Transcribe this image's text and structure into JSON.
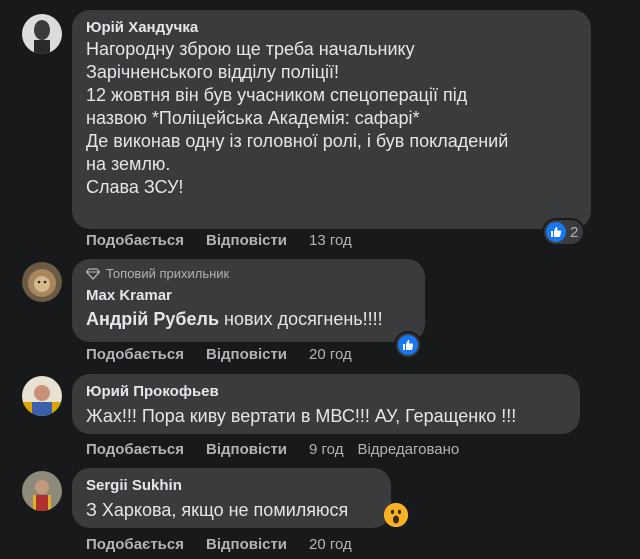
{
  "comments": [
    {
      "author": "Юрій Хандучка",
      "lines": [
        "Нагородну зброю ще треба начальнику",
        "Зарічненського відділу поліції!",
        "12 жовтня він був учасником спецоперації під",
        "назвою *Поліцейська Академія: сафарі*",
        "Де виконав одну із головної ролі, і був покладений",
        "на землю.",
        "Слава ЗСУ!"
      ],
      "like_label": "Подобається",
      "reply_label": "Відповісти",
      "time": "13 год",
      "reaction_count": "2",
      "reaction_icon": "like-icon"
    },
    {
      "badge": "Топовий прихильник",
      "author": "Max Kramar",
      "mention": "Андрій Рубель",
      "text": " нових досягнень!!!!",
      "like_label": "Подобається",
      "reply_label": "Відповісти",
      "time": "20 год",
      "reaction_icon": "like-icon"
    },
    {
      "author": "Юрий Прокофьев",
      "text": "Жах!!! Пора киву вертати в МВС!!! АУ, Геращенко !!!",
      "like_label": "Подобається",
      "reply_label": "Відповісти",
      "time": "9 год",
      "edited": "Відредаговано"
    },
    {
      "author": "Sergii Sukhin",
      "text": "З Харкова, якщо не помиляюся",
      "like_label": "Подобається",
      "reply_label": "Відповісти",
      "time": "20 год",
      "reaction_icon": "wow-icon"
    }
  ],
  "colors": {
    "background": "#18191a",
    "bubble": "#3a3b3c",
    "like_blue": "#1877f2",
    "muted_text": "#b0b3b8"
  }
}
